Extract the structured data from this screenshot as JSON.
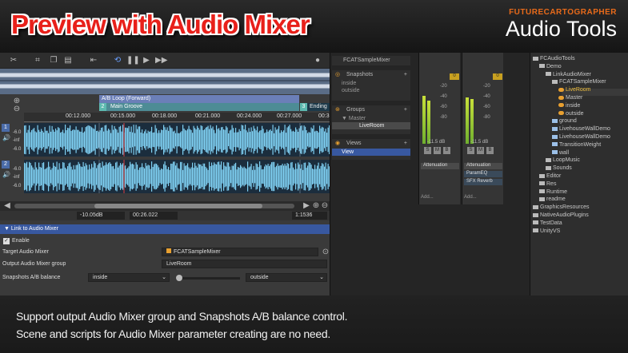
{
  "banner": {
    "title": "Preview with Audio Mixer",
    "brand_small": "FUTURECARTOGRAPHER",
    "brand_large": "Audio Tools"
  },
  "toolbar": {
    "icons": [
      "scissors-icon",
      "crop-icon",
      "copy-icon",
      "paste-icon",
      "loop-icon",
      "play-icon",
      "pause-icon",
      "play-button",
      "next-icon",
      "settings-icon"
    ]
  },
  "waveform": {
    "loop_label": "A/B Loop (Forward)",
    "marker_2": "2",
    "marker_3": "3",
    "groove_label": "Main Groove",
    "ending_label": "Ending",
    "ticks": [
      "00:12.000",
      "00:15.000",
      "00:18.000",
      "00:21.000",
      "00:24.000",
      "00:27.000",
      "00:3"
    ],
    "channel_1": "1",
    "channel_2": "2",
    "db_top": "-6.0",
    "db_inf": "-inf",
    "db_bottom": "-6.0",
    "db_top2": "-6.0",
    "db_inf2": "-inf",
    "db_bottom2": "-6.0"
  },
  "info": {
    "gain": "-10.05dB",
    "time": "00:26.022",
    "ratio": "1:1536"
  },
  "inspector": {
    "header": "Link to Audio Mixer",
    "enable_label": "Enable",
    "target_label": "Target Audio Mixer",
    "target_value": "FCATSampleMixer",
    "group_label": "Output Audio Mixer group",
    "group_value": "LiveRoom",
    "snapshots_label": "Snapshots A/B balance",
    "snap_a": "inside",
    "snap_b": "outside"
  },
  "mixer": {
    "mixer_name": "FCATSampleMixer",
    "snapshots_title": "Snapshots",
    "snap_1": "inside",
    "snap_2": "outside",
    "groups_title": "Groups",
    "group_master": "Master",
    "group_liveroom": "LiveRoom",
    "views_title": "Views",
    "view_1": "View",
    "strip_db": "-11.5 dB",
    "strip_db2": "-11.5 dB",
    "attenuation": "Attenuation",
    "attenuation2": "Attenuation",
    "paramEQ": "ParamEQ",
    "sfx_reverb": "SFX Reverb",
    "add": "Add...",
    "add2": "Add...",
    "scale": [
      "0",
      "-20",
      "-40",
      "-60",
      "-80"
    ],
    "solo_labels": [
      "S",
      "M",
      "B"
    ]
  },
  "hierarchy": {
    "items": [
      {
        "label": "FCAudioTools",
        "depth": 0
      },
      {
        "label": "Demo",
        "depth": 1
      },
      {
        "label": "LinkAudioMixer",
        "depth": 2
      },
      {
        "label": "FCATSampleMixer",
        "depth": 3
      },
      {
        "label": "LiveRoom",
        "depth": 4
      },
      {
        "label": "Master",
        "depth": 4
      },
      {
        "label": "inside",
        "depth": 4
      },
      {
        "label": "outside",
        "depth": 4
      },
      {
        "label": "ground",
        "depth": 3
      },
      {
        "label": "LivehouseWallDemo",
        "depth": 3
      },
      {
        "label": "LivehouseWallDemo",
        "depth": 3
      },
      {
        "label": "TransitionWeight",
        "depth": 3
      },
      {
        "label": "wall",
        "depth": 3
      },
      {
        "label": "LoopMusic",
        "depth": 2
      },
      {
        "label": "Sounds",
        "depth": 2
      },
      {
        "label": "Editor",
        "depth": 1
      },
      {
        "label": "Res",
        "depth": 1
      },
      {
        "label": "Runtime",
        "depth": 1
      },
      {
        "label": "readme",
        "depth": 1
      },
      {
        "label": "GraphicsResources",
        "depth": 0
      },
      {
        "label": "NativeAudioPlugins",
        "depth": 0
      },
      {
        "label": "TestData",
        "depth": 0
      },
      {
        "label": "UnityVS",
        "depth": 0
      }
    ]
  },
  "caption": {
    "line1": "Support output Audio Mixer group and  Snapshots A/B balance control.",
    "line2": "Scene and scripts for Audio Mixer  parameter creating are no need."
  }
}
